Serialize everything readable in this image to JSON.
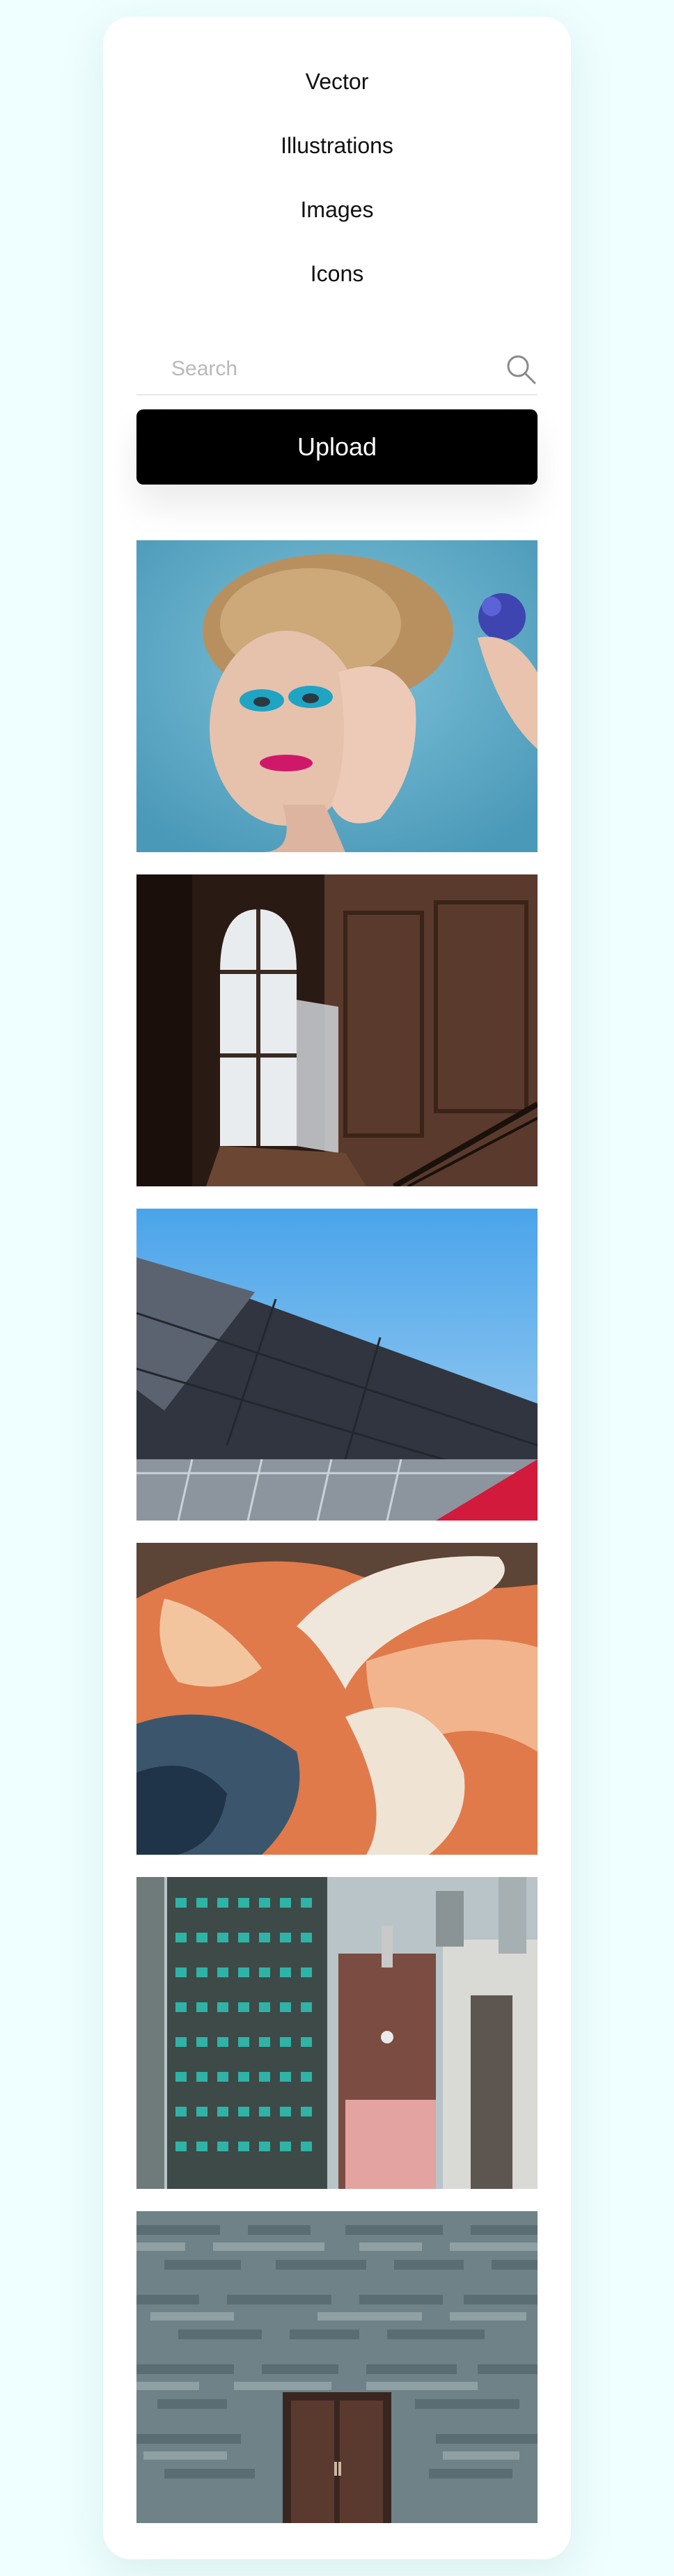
{
  "nav": {
    "items": [
      {
        "label": "Vector"
      },
      {
        "label": "Illustrations"
      },
      {
        "label": "Images"
      },
      {
        "label": "Icons"
      }
    ]
  },
  "search": {
    "placeholder": "Search",
    "value": "",
    "icon": "search-icon"
  },
  "upload": {
    "label": "Upload"
  },
  "gallery": {
    "items": [
      {
        "subject": "portrait-photo"
      },
      {
        "subject": "arched-window-photo"
      },
      {
        "subject": "dark-roof-photo"
      },
      {
        "subject": "aerial-landscape-photo"
      },
      {
        "subject": "city-buildings-photo"
      },
      {
        "subject": "stone-wall-door-photo"
      }
    ]
  },
  "colors": {
    "background": "#effefe",
    "card": "#ffffff",
    "button": "#000000",
    "button_text": "#ffffff"
  }
}
